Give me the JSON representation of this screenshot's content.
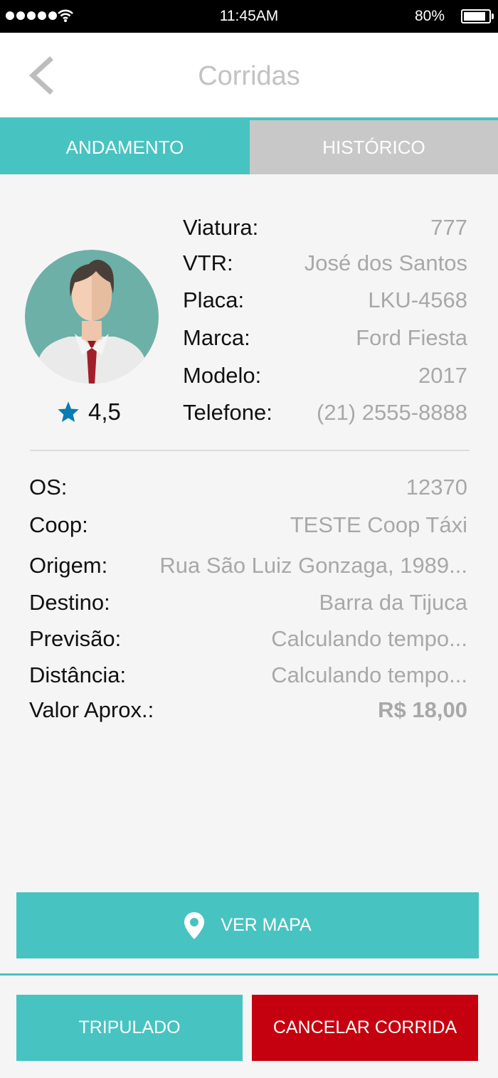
{
  "status_bar": {
    "time": "11:45AM",
    "battery": "80%"
  },
  "header": {
    "title": "Corridas"
  },
  "tabs": [
    {
      "label": "ANDAMENTO",
      "active": true
    },
    {
      "label": "HISTÓRICO",
      "active": false
    }
  ],
  "driver": {
    "rating": "4,5",
    "fields": [
      {
        "label": "Viatura:",
        "value": "777"
      },
      {
        "label": "VTR:",
        "value": "José dos Santos"
      },
      {
        "label": "Placa:",
        "value": "LKU-4568"
      },
      {
        "label": "Marca:",
        "value": "Ford Fiesta"
      },
      {
        "label": "Modelo:",
        "value": "2017"
      },
      {
        "label": "Telefone:",
        "value": "(21) 2555-8888"
      }
    ]
  },
  "trip": {
    "fields": [
      {
        "label": "OS:",
        "value": "12370"
      },
      {
        "label": "Coop:",
        "value": "TESTE Coop Táxi"
      },
      {
        "label": "Origem:",
        "value": "Rua São Luiz Gonzaga, 1989..."
      },
      {
        "label": "Destino:",
        "value": "Barra da Tijuca"
      },
      {
        "label": "Previsão:",
        "value": "Calculando tempo..."
      },
      {
        "label": "Distância:",
        "value": "Calculando tempo..."
      },
      {
        "label": "Valor Aprox.:",
        "value": "R$ 18,00"
      }
    ]
  },
  "buttons": {
    "map": "VER MAPA",
    "tripulado": "TRIPULADO",
    "cancel": "CANCELAR CORRIDA"
  },
  "colors": {
    "accent": "#47c3c1",
    "danger": "#c5000f",
    "star": "#0a7bb3",
    "tab_inactive": "#c8c8c8"
  },
  "icons": {
    "back": "chevron-left-icon",
    "star": "star-icon",
    "map": "location-pin-icon",
    "wifi": "wifi-icon",
    "battery": "battery-icon"
  }
}
